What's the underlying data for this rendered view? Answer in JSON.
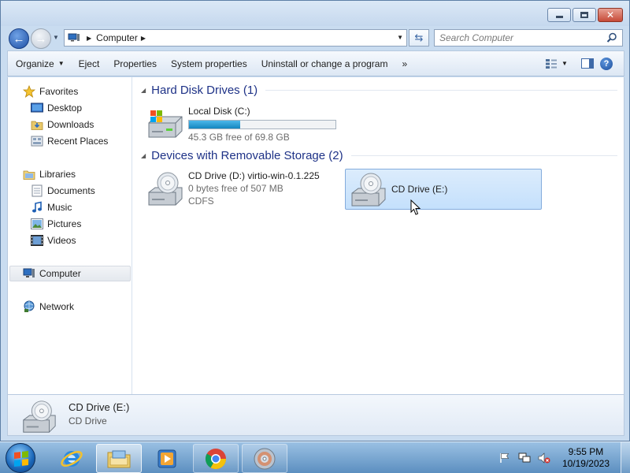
{
  "window": {
    "caption_buttons": [
      "minimize",
      "maximize",
      "close"
    ]
  },
  "address": {
    "crumb": "Computer",
    "icon": "computer-icon"
  },
  "search": {
    "placeholder": "Search Computer"
  },
  "commands": {
    "organize": "Organize",
    "eject": "Eject",
    "properties": "Properties",
    "system_properties": "System properties",
    "uninstall": "Uninstall or change a program",
    "more": "»"
  },
  "nav": {
    "favorites": "Favorites",
    "desktop": "Desktop",
    "downloads": "Downloads",
    "recent_places": "Recent Places",
    "libraries": "Libraries",
    "documents": "Documents",
    "music": "Music",
    "pictures": "Pictures",
    "videos": "Videos",
    "computer": "Computer",
    "network": "Network"
  },
  "groups": {
    "hard_disk": "Hard Disk Drives (1)",
    "removable": "Devices with Removable Storage (2)"
  },
  "drives": {
    "c": {
      "name": "Local Disk (C:)",
      "free": "45.3 GB free of 69.8 GB",
      "used_fraction": 0.351
    },
    "d": {
      "name": "CD Drive (D:) virtio-win-0.1.225",
      "free": "0 bytes free of 507 MB",
      "fs": "CDFS"
    },
    "e": {
      "name": "CD Drive (E:)"
    }
  },
  "details": {
    "name": "CD Drive (E:)",
    "type": "CD Drive"
  },
  "taskbar": {
    "time": "9:55 PM",
    "date": "10/19/2023"
  },
  "colors": {
    "group_header": "#1e3287",
    "bar_fill": "#1486bf",
    "selection": "#c4e0fc"
  }
}
